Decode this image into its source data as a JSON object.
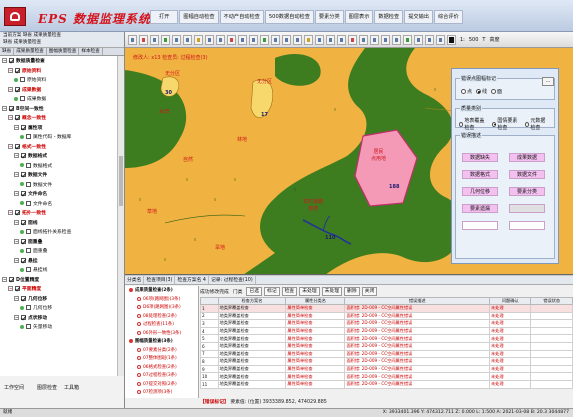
{
  "app": {
    "title": "EPS 数据监理系统"
  },
  "menu": [
    "打开",
    "图幅自动检查",
    "不动产自动检查",
    "500数据自动检查",
    "要素分类",
    "图层表示",
    "数据检查",
    "提交输出",
    "综合评价"
  ],
  "toolbar": {
    "scale_label": "1:",
    "scale_value": "500",
    "mode_label": "T",
    "mode2_label": "高度"
  },
  "left_panel": {
    "header_rows": [
      "当前方案  缺省  成果质量检查",
      "缺省  成果质量检查"
    ],
    "tabs": [
      "缺省",
      "成果质量检查",
      "图幅质量检查",
      "样本检查"
    ],
    "tree": [
      {
        "label": "数据质量检查",
        "checked": true,
        "level": 0,
        "bold": true
      },
      {
        "label": "原始资料",
        "checked": true,
        "level": 1,
        "bold": true,
        "red": true
      },
      {
        "label": "原始资料",
        "checked": false,
        "level": 2
      },
      {
        "label": "成果数据",
        "checked": true,
        "level": 1,
        "bold": true,
        "red": true
      },
      {
        "label": "成果数据",
        "checked": false,
        "level": 2
      },
      {
        "label": "B空间一致性",
        "checked": true,
        "level": 0,
        "bold": true
      },
      {
        "label": "概念一致性",
        "checked": true,
        "level": 1,
        "bold": true,
        "red": true
      },
      {
        "label": "属性项",
        "checked": true,
        "level": 2,
        "bold": true
      },
      {
        "label": "属性代码 - 数据库",
        "checked": false,
        "level": 3
      },
      {
        "label": "格式一致性",
        "checked": true,
        "level": 1,
        "bold": true,
        "red": true
      },
      {
        "label": "数据格式",
        "checked": true,
        "level": 2,
        "bold": true
      },
      {
        "label": "数据格式",
        "checked": false,
        "level": 3
      },
      {
        "label": "数据文件",
        "checked": true,
        "level": 2,
        "bold": true
      },
      {
        "label": "数据文件",
        "checked": false,
        "level": 3
      },
      {
        "label": "文件命名",
        "checked": true,
        "level": 2,
        "bold": true
      },
      {
        "label": "文件命名",
        "checked": false,
        "level": 3
      },
      {
        "label": "拓扑一致性",
        "checked": true,
        "level": 1,
        "bold": true,
        "red": true
      },
      {
        "label": "面线",
        "checked": true,
        "level": 2,
        "bold": true
      },
      {
        "label": "面线拓扑关系检查",
        "checked": false,
        "level": 3
      },
      {
        "label": "面重叠",
        "checked": true,
        "level": 2,
        "bold": true
      },
      {
        "label": "面重叠",
        "checked": false,
        "level": 3
      },
      {
        "label": "悬挂",
        "checked": true,
        "level": 2,
        "bold": true
      },
      {
        "label": "悬挂线",
        "checked": false,
        "level": 3
      },
      {
        "label": "D位置精度",
        "checked": true,
        "level": 0,
        "bold": true
      },
      {
        "label": "平面精度",
        "checked": true,
        "level": 1,
        "bold": true,
        "red": true
      },
      {
        "label": "几何位移",
        "checked": true,
        "level": 2,
        "bold": true
      },
      {
        "label": "几何位移",
        "checked": false,
        "level": 3
      },
      {
        "label": "点状移动",
        "checked": true,
        "level": 2,
        "bold": true
      },
      {
        "label": "矢量移动",
        "checked": false,
        "level": 3
      }
    ],
    "bottom_tabs": [
      "工作空间",
      "图层检查",
      "工具箱"
    ]
  },
  "map": {
    "top_label": "修改人: x13   检查员: 过程检查(3)",
    "labels": [
      {
        "text": "无分区",
        "color": "#d0161c"
      },
      {
        "text": "无分区",
        "color": "#d0161c"
      },
      {
        "text": "水田",
        "color": "#d0161c"
      },
      {
        "text": "林地",
        "color": "#d0161c"
      },
      {
        "text": "自然",
        "color": "#d0161c"
      },
      {
        "text": "草地",
        "color": "#d0161c"
      },
      {
        "text": "旱地",
        "color": "#d0161c"
      },
      {
        "text": "居民\n点用地",
        "color": "#d0161c"
      },
      {
        "text": "农村道路\n用地",
        "color": "#d0161c"
      }
    ],
    "numbers": [
      "30",
      "17",
      "188",
      "110"
    ]
  },
  "dialog": {
    "group1_title": "错误点图幅标记",
    "radio1": [
      {
        "label": "点",
        "on": false
      },
      {
        "label": "线",
        "on": true
      },
      {
        "label": "面",
        "on": false
      }
    ],
    "close_label": "...",
    "group2_title": "质量类别",
    "radio2": [
      {
        "label": "地表覆盖检查",
        "on": false
      },
      {
        "label": "国情要素检查",
        "on": true
      },
      {
        "label": "元数据检查",
        "on": false
      }
    ],
    "group3_title": "错误描述",
    "buttons": [
      {
        "label": "数据缺失",
        "bg": "#f4c0f0"
      },
      {
        "label": "成果数据",
        "bg": "#f4c0f0"
      },
      {
        "label": "数据格式",
        "bg": "#f4c0f0"
      },
      {
        "label": "数据文件",
        "bg": "#f4c0f0"
      },
      {
        "label": "几何位移",
        "bg": "#f4c0f0"
      },
      {
        "label": "要素分类",
        "bg": "#f4c0f0"
      },
      {
        "label": "要素遗漏",
        "bg": "#f4c0f0"
      },
      {
        "label": "",
        "bg": "#e0e0e0"
      },
      {
        "label": "",
        "bg": "#ffffff"
      },
      {
        "label": "",
        "bg": "#ffffff"
      }
    ]
  },
  "bottom": {
    "tabs": [
      "分类名",
      "检查项目(3)",
      "检查方案名 4",
      "记录: 过程检查(10)"
    ],
    "tree": [
      {
        "label": "成果质量检查(2条)",
        "level": 1
      },
      {
        "label": "06项(路网图)(3条)",
        "level": 2
      },
      {
        "label": "D6项(路网图)(3条)",
        "level": 2
      },
      {
        "label": "08处理检查(2条)",
        "level": 2
      },
      {
        "label": "过程检查(11条)",
        "level": 2
      },
      {
        "label": "06外形一致性(3条)",
        "level": 2
      },
      {
        "label": "图幅质量检查(3条)",
        "level": 1
      },
      {
        "label": "07要素分类(2条)",
        "level": 2
      },
      {
        "label": "07整体图斑(1条)",
        "level": 2
      },
      {
        "label": "06格式检查(2条)",
        "level": 2
      },
      {
        "label": "07过程检查(3条)",
        "level": 2
      },
      {
        "label": "07提交对照(2条)",
        "level": 2
      },
      {
        "label": "07检测项(3条)",
        "level": 2
      }
    ],
    "grid_toolbar": {
      "status_label": "成功修改完成",
      "filter_label": "门类",
      "buttons": [
        "已选",
        "标记",
        "检查",
        "未处理",
        "未处理",
        "删除"
      ],
      "close_label": "关闭"
    },
    "columns": [
      "",
      "检查方案名",
      "属性分类名",
      "错误描述",
      "问题确认",
      "错误状态"
    ],
    "rows": [
      [
        "1",
        "地类界覆盖检查",
        "属性简单检查",
        "面积错: 2D-009 - CC空间属性错误",
        "未处理",
        ""
      ],
      [
        "2",
        "地类界覆盖检查",
        "属性简单检查",
        "面积错: 2D-009 - CC空间属性错误",
        "未处理",
        ""
      ],
      [
        "3",
        "地类界覆盖检查",
        "属性简单检查",
        "面积错: 2D-009 - CC空间属性错误",
        "未处理",
        ""
      ],
      [
        "4",
        "地类界覆盖检查",
        "属性简单检查",
        "面积错: 2D-009 - CC空间属性错误",
        "未处理",
        ""
      ],
      [
        "5",
        "地类界覆盖检查",
        "属性简单检查",
        "面积错: 2D-009 - CC空间属性错误",
        "未处理",
        ""
      ],
      [
        "6",
        "地类界覆盖检查",
        "属性简单检查",
        "面积错: 2D-009 - CC空间属性错误",
        "未处理",
        ""
      ],
      [
        "7",
        "地类界覆盖检查",
        "属性简单检查",
        "面积错: 2D-009 - CC空间属性错误",
        "未处理",
        ""
      ],
      [
        "8",
        "地类界覆盖检查",
        "属性简单检查",
        "面积错: 2D-009 - CC空间属性错误",
        "未处理",
        ""
      ],
      [
        "9",
        "地类界覆盖检查",
        "属性简单检查",
        "面积错: 2D-009 - CC空间属性错误",
        "未处理",
        ""
      ],
      [
        "10",
        "地类界覆盖检查",
        "属性简单检查",
        "面积错: 2D-009 - CC空间属性错误",
        "未处理",
        ""
      ],
      [
        "11",
        "地类界覆盖检查",
        "属性简单检查",
        "面积错: 2D-009 - CC空间属性错误",
        "未处理",
        ""
      ]
    ],
    "status_prefix": "【错误标记】",
    "status_text": "要素值: (位置) 3933389.852, 474029.885"
  },
  "statusbar": {
    "left": "就绪",
    "right": "X: 3933401.396  Y: 474312.711  Z: 0.000  L: 1:500  A: 2021-03-08  B: 20.3  3044877"
  }
}
